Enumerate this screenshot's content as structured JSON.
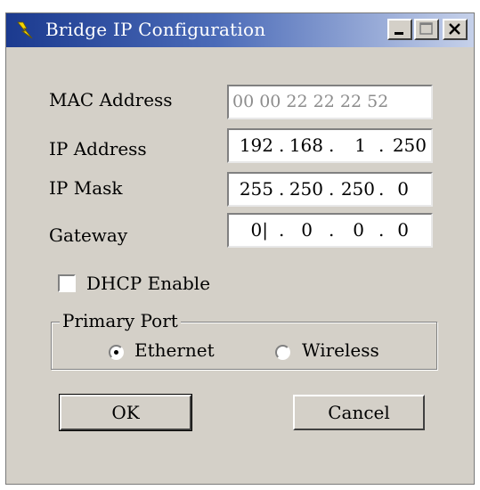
{
  "window": {
    "title": "Bridge IP Configuration"
  },
  "title_buttons": {
    "minimize": "_",
    "maximize": "□",
    "close": "X"
  },
  "fields": {
    "mac": {
      "label": "MAC Address",
      "value": "00 00 22 22 22 52"
    },
    "ip": {
      "label": "IP Address",
      "octets": [
        "192",
        "168",
        "1",
        "250"
      ]
    },
    "mask": {
      "label": "IP Mask",
      "octets": [
        "255",
        "250",
        "250",
        "0"
      ]
    },
    "gateway": {
      "label": "Gateway",
      "octets": [
        "0|",
        "0",
        "0",
        "0"
      ]
    }
  },
  "dhcp": {
    "label": "DHCP Enable",
    "checked": false
  },
  "primary_port": {
    "legend": "Primary Port",
    "options": [
      {
        "label": "Ethernet",
        "selected": true
      },
      {
        "label": "Wireless",
        "selected": false
      }
    ]
  },
  "buttons": {
    "ok": "OK",
    "cancel": "Cancel"
  }
}
